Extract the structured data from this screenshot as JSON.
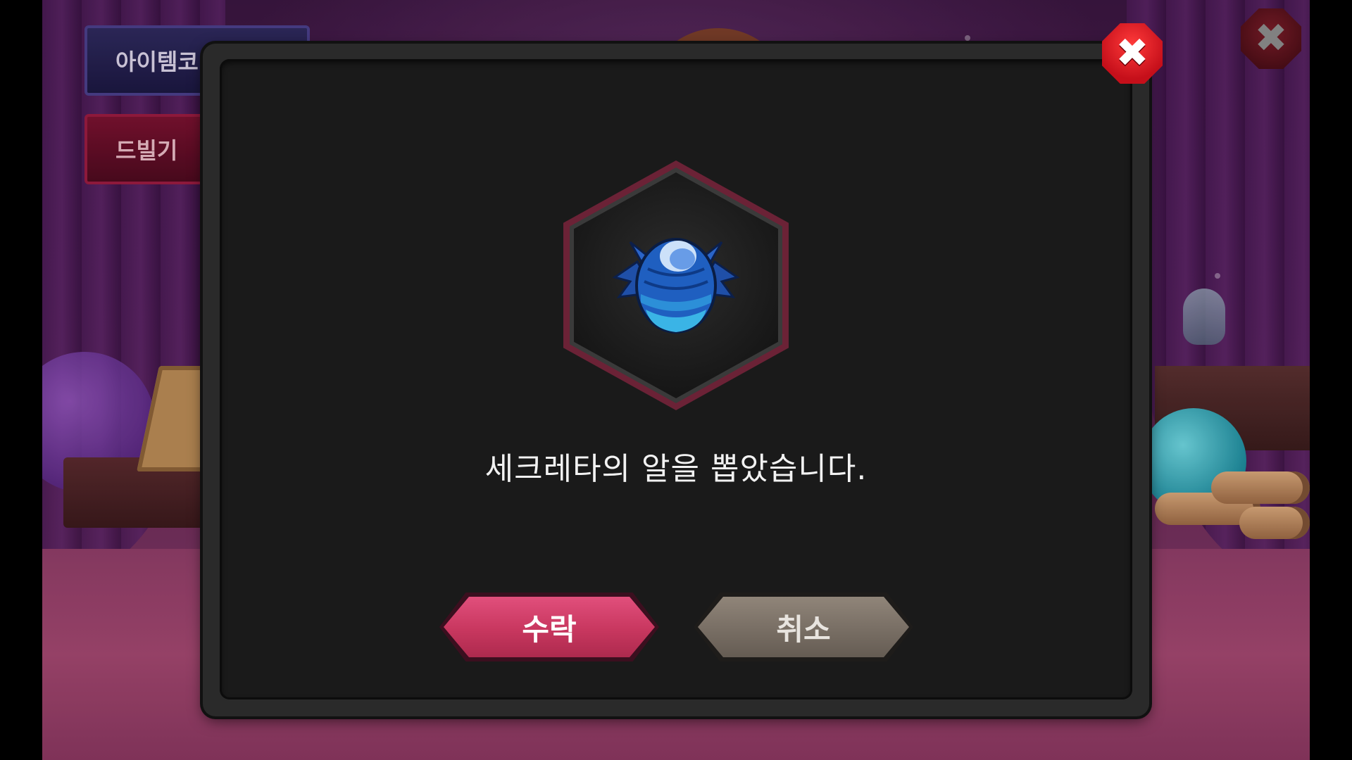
{
  "background": {
    "side_buttons": {
      "item_code_label": "아이템코",
      "dev_label": "드빌기"
    },
    "close_icon": "close-icon"
  },
  "dialog": {
    "item_icon": "blue-egg-icon",
    "message": "세크레타의 알을 뽑았습니다.",
    "accept_label": "수락",
    "cancel_label": "취소",
    "close_icon": "close-icon"
  },
  "colors": {
    "accept": "#c8375f",
    "cancel": "#786e64",
    "close": "#d21c24",
    "frame_border": "#6b2236"
  }
}
